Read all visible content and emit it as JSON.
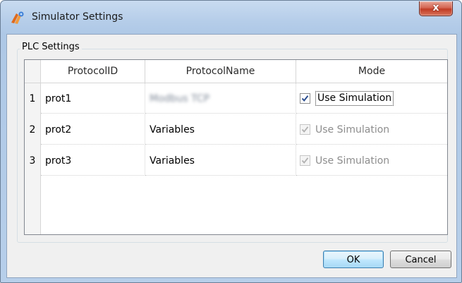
{
  "window": {
    "title": "Simulator Settings",
    "close_label": "x"
  },
  "group": {
    "title": "PLC Settings"
  },
  "grid": {
    "columns": [
      "ProtocolID",
      "ProtocolName",
      "Mode"
    ],
    "rows": [
      {
        "num": "1",
        "protocol_id": "prot1",
        "protocol_name": "Modbus TCP",
        "mode_label": "Use Simulation",
        "checked": true,
        "enabled": true
      },
      {
        "num": "2",
        "protocol_id": "prot2",
        "protocol_name": "Variables",
        "mode_label": "Use Simulation",
        "checked": true,
        "enabled": false
      },
      {
        "num": "3",
        "protocol_id": "prot3",
        "protocol_name": "Variables",
        "mode_label": "Use Simulation",
        "checked": true,
        "enabled": false
      }
    ]
  },
  "buttons": {
    "ok": "OK",
    "cancel": "Cancel"
  },
  "colors": {
    "title_bar": "#b5cde9",
    "close_button": "#c13c25",
    "default_button_border": "#3c7fb1"
  },
  "icons": {
    "app": "simulator-app-icon",
    "close": "close-icon"
  }
}
